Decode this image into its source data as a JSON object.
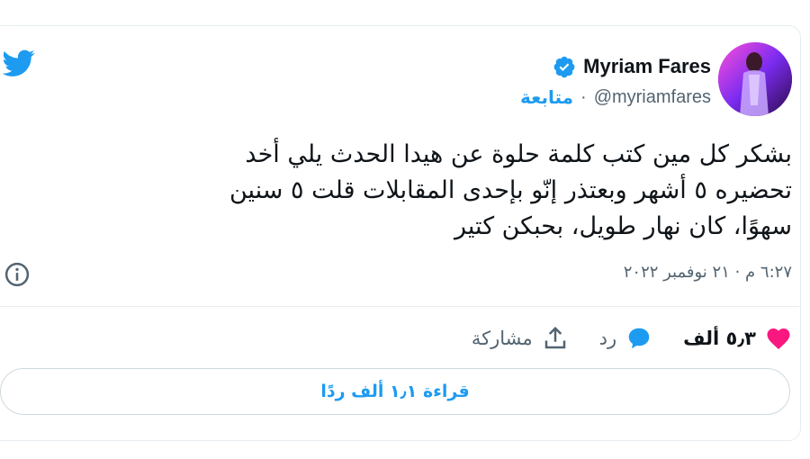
{
  "author": {
    "name": "Myriam Fares",
    "handle": "@myriamfares",
    "separator": "·",
    "follow_label": "متابعة"
  },
  "tweet": {
    "text_lines": [
      "بشكر كل مين كتب كلمة حلوة عن هيدا الحدث يلي أخد",
      "تحضيره ٥ أشهر وبعتذر إنّو بإحدى المقابلات قلت ٥ سنين",
      "سهوًا، كان نهار طويل، بحبكن كتير"
    ],
    "timestamp": "٦:٢٧ م · ٢١ نوفمبر ٢٠٢٢"
  },
  "actions": {
    "like_count": "٥٫٣ ألف",
    "reply_label": "رد",
    "share_label": "مشاركة"
  },
  "replies_button": "قراءة ١٫١ ألف ردًا",
  "colors": {
    "accent": "#1d9bf0",
    "like": "#f91880",
    "text": "#0f1419",
    "muted": "#536471"
  },
  "icons": [
    "twitter-bird-icon",
    "verified-badge-icon",
    "info-icon",
    "heart-icon",
    "reply-bubble-icon",
    "share-icon"
  ]
}
